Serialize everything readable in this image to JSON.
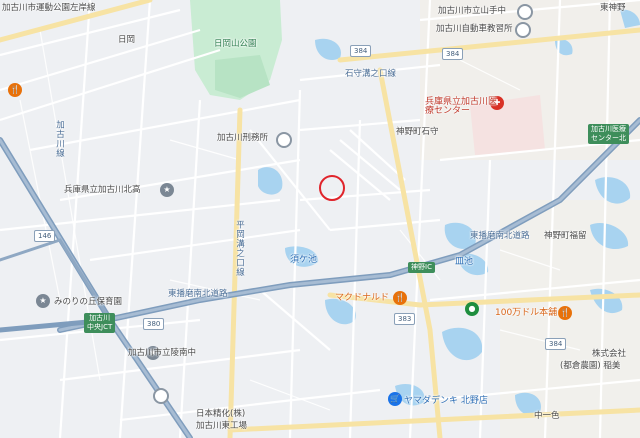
{
  "labels": {
    "kakogawa_shi_yamate": "加古川市立山手中",
    "higashi_kanno": "東神野",
    "jidosha_kyoshujo": "加古川自動車教習所",
    "kakogawa_saihoku": "加古川市運動公園左岸線",
    "hioka": "日岡",
    "hioka_yama_park": "日岡山公園",
    "ishimori_road": "石守溝之口線",
    "hospital": "兵庫県立加古川医療センター",
    "kanno_ishimori": "神野町石守",
    "betsumu": "加古川刑務所",
    "kakogawa_kitako": "兵庫県立加古川北高",
    "kanno_fukuryu": "神野町福留",
    "kakogawa_line": "加古川線",
    "hirayama_road": "平岡溝之口線",
    "sake_ike": "皿池",
    "bano": "播池",
    "sudaike": "須ケ池",
    "mcdonalds": "マクドナルド",
    "higashi_harima_north": "東播磨南北道路",
    "mino_nori": "みのりの丘保育園",
    "lihuolian": "100万ドル本舗",
    "kakogawa_toyo": "加古川市立陵南中",
    "yamada": "ヤマダデンキ 北野店",
    "nihon_seika": "日本精化(株)",
    "kakogawa_east": "加古川東工場",
    "naka_isshiki": "中一色",
    "corporation": "株式会社",
    "toshinoken": "(都倉農園) 稲美",
    "kakogawa_line_2": "加古川線"
  },
  "shields": {
    "r384a": "384",
    "r384b": "384",
    "r384c": "384",
    "r146": "146",
    "r383": "383",
    "r380": "380",
    "r383b": "383"
  },
  "green_boxes": {
    "jct": "加古川\n中央JCT",
    "kanno_ic": "神野IC",
    "med_center": "加古川医療\nセンター北"
  },
  "icons": {
    "target_marker": "red-circle-target",
    "hospital_icon": "hospital-icon",
    "school_icon": "school-icon",
    "restaurant_icon": "restaurant-icon",
    "shop_icon": "shopping-icon",
    "park_icon": "park-icon",
    "place_icon": "place-icon"
  }
}
